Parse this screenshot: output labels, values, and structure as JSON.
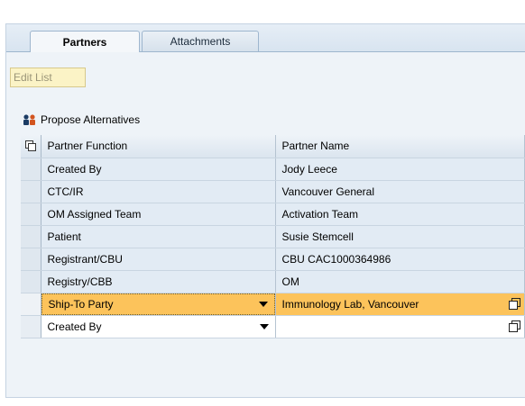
{
  "tabs": [
    {
      "label": "Partners",
      "active": true
    },
    {
      "label": "Attachments",
      "active": false
    }
  ],
  "toolbar": {
    "edit_list_label": "Edit List",
    "propose_label": "Propose Alternatives"
  },
  "table": {
    "columns": [
      "Partner Function",
      "Partner Name"
    ],
    "rows": [
      {
        "function": "Created By",
        "name": "Jody Leece"
      },
      {
        "function": "CTC/IR",
        "name": "Vancouver General"
      },
      {
        "function": "OM Assigned Team",
        "name": "Activation Team"
      },
      {
        "function": "Patient",
        "name": "Susie Stemcell"
      },
      {
        "function": "Registrant/CBU",
        "name": "CBU CAC1000364986"
      },
      {
        "function": "Registry/CBB",
        "name": "OM"
      },
      {
        "function": "Ship-To Party",
        "name": "Immunology Lab, Vancouver"
      },
      {
        "function": "Created By",
        "name": ""
      }
    ]
  },
  "colors": {
    "highlight_row": "#fcc35b",
    "row_bg": "#e2ebf4",
    "edit_list_bg": "#fbf3c6"
  }
}
